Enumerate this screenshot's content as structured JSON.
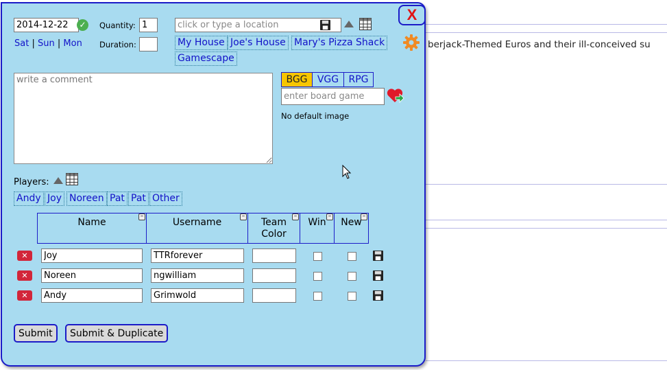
{
  "background": {
    "text": "berjack-Themed Euros and their ill-conceived su"
  },
  "dialog": {
    "close_label": "X",
    "date": {
      "value": "2014-12-22"
    },
    "days": {
      "sat": "Sat",
      "sun": "Sun",
      "mon": "Mon",
      "sep": "|"
    },
    "quantity": {
      "label": "Quantity:",
      "value": "1"
    },
    "duration": {
      "label": "Duration:",
      "value": ""
    },
    "location": {
      "placeholder": "click or type a location",
      "favorites": [
        "My House",
        "Joe's House",
        "Mary's Pizza Shack",
        "Gamescape"
      ]
    },
    "comment": {
      "placeholder": "write a comment"
    },
    "game_tabs": [
      "BGG",
      "VGG",
      "RPG"
    ],
    "game": {
      "placeholder": "enter board game",
      "no_image": "No default image"
    },
    "players": {
      "label": "Players:",
      "quick": [
        "Andy",
        "Joy",
        "Noreen",
        "Pat",
        "Pat",
        "Other"
      ]
    },
    "table": {
      "headers": [
        "Name",
        "Username",
        "Team Color",
        "Win",
        "New"
      ],
      "rows": [
        {
          "name": "Joy",
          "username": "TTRforever",
          "team": "",
          "win": false,
          "new": false
        },
        {
          "name": "Noreen",
          "username": "ngwilliam",
          "team": "",
          "win": false,
          "new": false
        },
        {
          "name": "Andy",
          "username": "Grimwold",
          "team": "",
          "win": false,
          "new": false
        }
      ]
    },
    "buttons": {
      "submit": "Submit",
      "submit_dup": "Submit & Duplicate"
    }
  },
  "colors": {
    "dialog_bg": "#a8dbf0",
    "border": "#1b1bc8",
    "link": "#1212c8",
    "active_tab": "#f7c600",
    "close": "#e01414"
  }
}
